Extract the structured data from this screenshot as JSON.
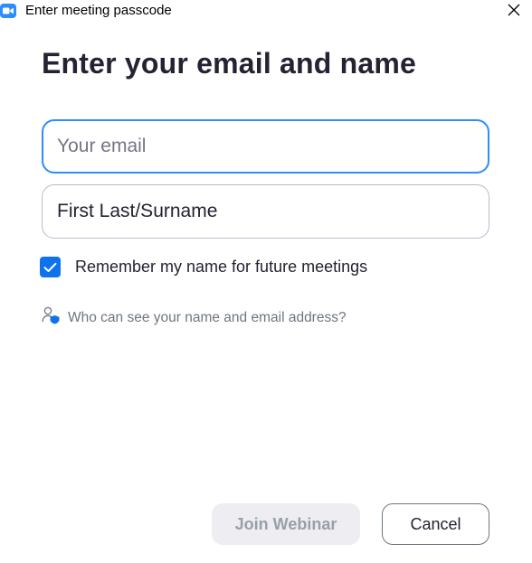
{
  "window": {
    "title": "Enter meeting passcode",
    "app_icon": "video-camera-icon",
    "close_icon": "close-icon"
  },
  "main": {
    "heading": "Enter your email and name"
  },
  "form": {
    "email": {
      "value": "",
      "placeholder": "Your email",
      "focused": true
    },
    "name": {
      "value": "First Last/Surname",
      "placeholder": ""
    },
    "remember": {
      "checked": true,
      "label": "Remember my name for future meetings"
    },
    "privacy_link": {
      "icon": "user-shield-icon",
      "label": "Who can see your name and email address?"
    }
  },
  "buttons": {
    "join_label": "Join Webinar",
    "join_enabled": false,
    "cancel_label": "Cancel"
  },
  "colors": {
    "accent": "#2d8cff",
    "checkbox": "#0e72ed",
    "heading": "#232333",
    "muted_text": "#6e7680",
    "disabled_button_bg": "#ededf2"
  }
}
